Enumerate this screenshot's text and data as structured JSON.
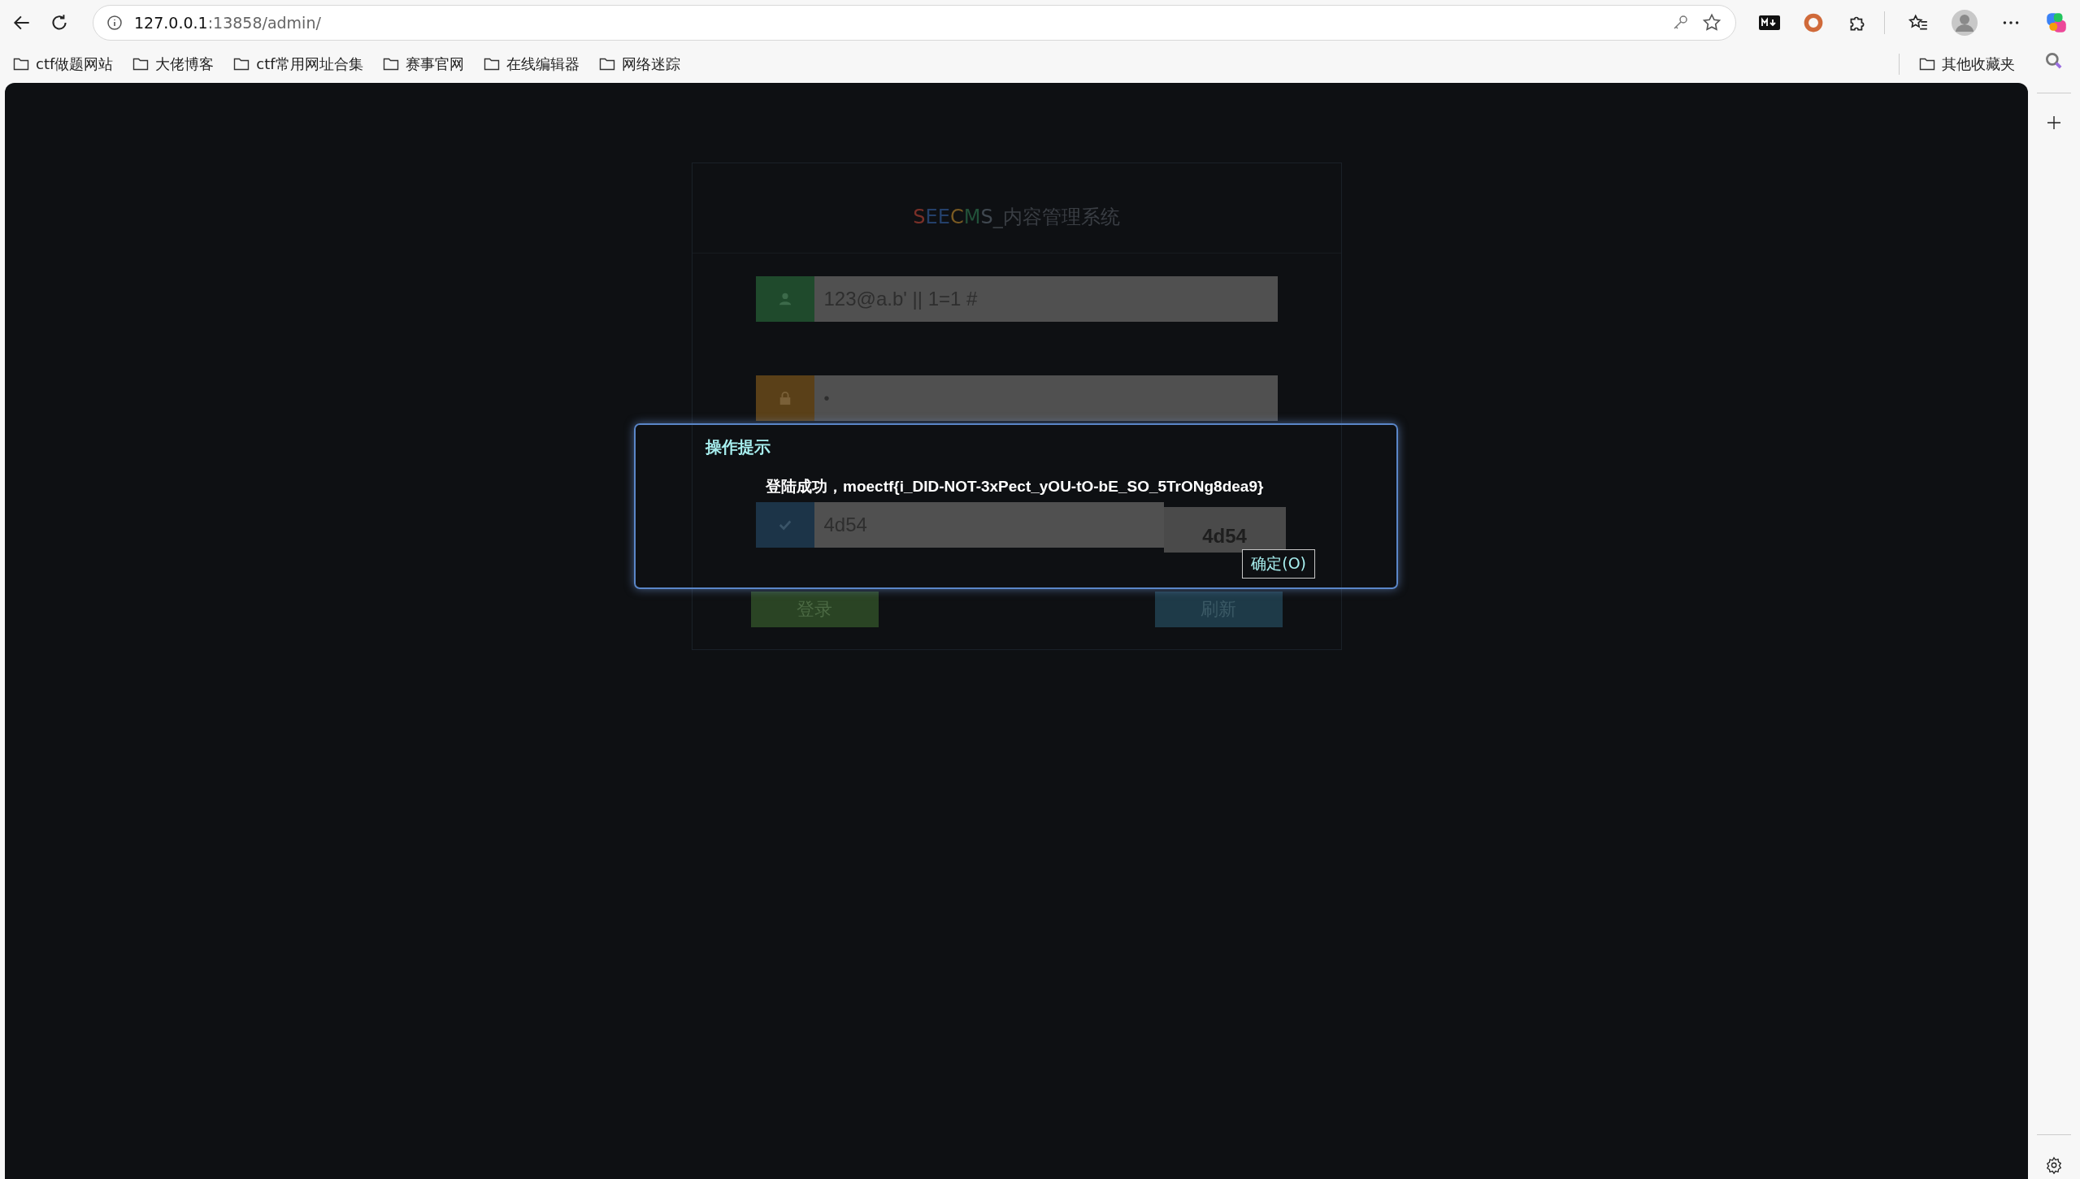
{
  "browser": {
    "url_host": "127.0.0.1",
    "url_rest": ":13858/admin/"
  },
  "bookmarks": [
    {
      "label": "ctf做题网站"
    },
    {
      "label": "大佬博客"
    },
    {
      "label": "ctf常用网址合集"
    },
    {
      "label": "赛事官网"
    },
    {
      "label": "在线编辑器"
    },
    {
      "label": "网络迷踪"
    }
  ],
  "other_bookmarks": "其他收藏夹",
  "login": {
    "logo_letters": [
      {
        "text": "S",
        "color": "#7a3028"
      },
      {
        "text": "E",
        "color": "#24406a"
      },
      {
        "text": "E",
        "color": "#24406a"
      },
      {
        "text": "C",
        "color": "#7a5a22"
      },
      {
        "text": "M",
        "color": "#22523a"
      },
      {
        "text": "S",
        "color": "#404850"
      }
    ],
    "title_suffix": "_内容管理系统",
    "fields": [
      {
        "kind": "text",
        "value": "123@a.b' || 1=1 #",
        "color": "#1f4a2c"
      },
      {
        "kind": "password",
        "value": "•",
        "color": "#5a4018"
      },
      {
        "kind": "captcha",
        "value": "4d54",
        "captcha_image": "4d54",
        "color": "#1c3448"
      }
    ],
    "buttons": [
      {
        "label": "登录",
        "color": "#2a4424"
      },
      {
        "label": "刷新",
        "color": "#1e3a48"
      }
    ]
  },
  "dialog": {
    "title": "操作提示",
    "message": "登陆成功，moectf{i_DID-NOT-3xPect_yOU-tO-bE_SO_5TrONg8dea9}",
    "ok": "确定(O)"
  }
}
